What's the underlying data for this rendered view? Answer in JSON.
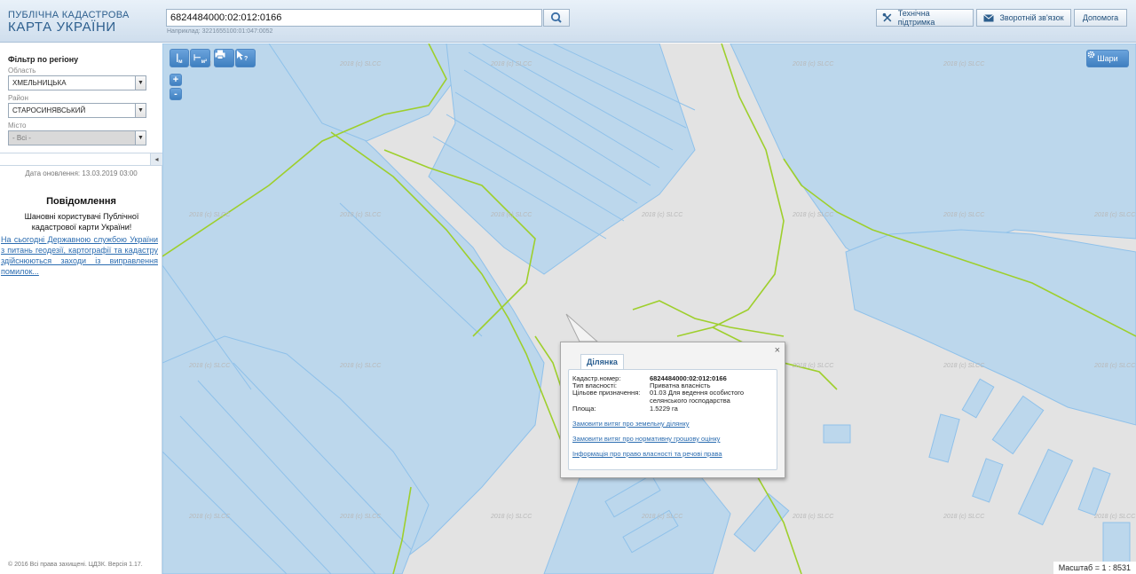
{
  "header": {
    "logo_line1": "ПУБЛІЧНА КАДАСТРОВА",
    "logo_line2": "КАРТА УКРАЇНИ",
    "search_value": "6824484000:02:012:0166",
    "search_hint": "Наприклад: 3221655100:01:047:0052",
    "support_label": "Технічна підтримка",
    "feedback_label": "Зворотній зв'язок",
    "help_label": "Допомога"
  },
  "filter": {
    "title": "Фільтр по регіону",
    "oblast_label": "Область",
    "oblast_value": "ХМЕЛЬНИЦЬКА",
    "rayon_label": "Район",
    "rayon_value": "СТАРОСИНЯВСЬКИЙ",
    "city_label": "Місто",
    "city_value": "- Всі -"
  },
  "sidebar": {
    "update_date": "Дата оновлення: 13.03.2019 03:00",
    "notice_title": "Повідомлення",
    "notice_text": "Шановні користувачі Публічної кадастрової карти України!",
    "notice_link": "На сьогодні Державною службою України з питань геодезії, картографії та кадастру здійснюються заходи із виправлення помилок...",
    "copyright": "© 2016 Всі права захищені. ЦДЗК. Версія 1.17."
  },
  "map": {
    "tools": {
      "ruler": "|",
      "ruler_sub": "м",
      "area": "⊢",
      "area_sub": "м²",
      "zoom_in": "+",
      "zoom_out": "-"
    },
    "layers_label": "Шари",
    "scale": "Масштаб = 1 : 8531",
    "watermark": "2018 (c) SLCC"
  },
  "popup": {
    "tab": "Ділянка",
    "cadastr_label": "Кадастр.номер:",
    "cadastr_value": "6824484000:02:012:0166",
    "ownership_label": "Тип власності:",
    "ownership_value": "Приватна власність",
    "purpose_label": "Цільове призначення:",
    "purpose_value": "01.03 Для ведення особистого селянського господарства",
    "area_label": "Площа:",
    "area_value": "1.5229 га",
    "link1": "Замовити витяг про земельну ділянку",
    "link2": "Замовити витяг про нормативну грошову оцінку",
    "link3": "Інформація про право власності та речові права",
    "close": "×"
  },
  "colors": {
    "parcel_fill": "#bcd7ec",
    "parcel_stroke": "#8fc1ea",
    "boundary_green": "#9ecf2c",
    "road_gray": "#e3e3e3"
  }
}
